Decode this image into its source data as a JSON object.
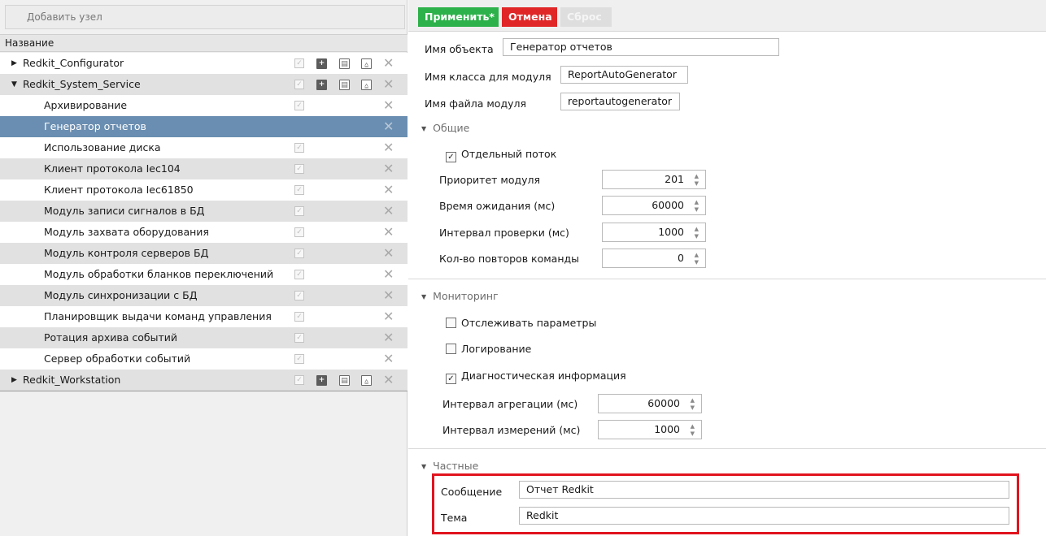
{
  "left_pane": {
    "add_node": "Добавить узел",
    "column_header": "Название",
    "tree": [
      {
        "label": "Redkit_Configurator",
        "level": 0,
        "arrow": "▶",
        "tools": true
      },
      {
        "label": "Redkit_System_Service",
        "level": 0,
        "arrow": "▼",
        "tools": true
      },
      {
        "label": "Архивирование",
        "level": 1
      },
      {
        "label": "Генератор отчетов",
        "level": 1,
        "selected": true
      },
      {
        "label": "Использование диска",
        "level": 1
      },
      {
        "label": "Клиент протокола Iec104",
        "level": 1
      },
      {
        "label": "Клиент протокола Iec61850",
        "level": 1
      },
      {
        "label": "Модуль записи сигналов в БД",
        "level": 1
      },
      {
        "label": "Модуль захвата оборудования",
        "level": 1
      },
      {
        "label": "Модуль контроля серверов БД",
        "level": 1
      },
      {
        "label": "Модуль обработки бланков переключений",
        "level": 1
      },
      {
        "label": "Модуль синхронизации с БД",
        "level": 1
      },
      {
        "label": "Планировщик выдачи команд управления",
        "level": 1
      },
      {
        "label": "Ротация архива событий",
        "level": 1
      },
      {
        "label": "Сервер обработки событий",
        "level": 1
      },
      {
        "label": "Redkit_Workstation",
        "level": 0,
        "arrow": "▶",
        "tools": true
      }
    ]
  },
  "toolbar": {
    "apply_label": "Применить*",
    "cancel_label": "Отмена",
    "reset_label": "Сброс",
    "colors": {
      "apply": "#2db14a",
      "cancel": "#e02626",
      "reset": "#dedede"
    }
  },
  "properties": {
    "object_name_label": "Имя объекта",
    "object_name_value": "Генератор отчетов",
    "module_class_label": "Имя класса для модуля",
    "module_class_value": "ReportAutoGenerator",
    "module_file_label": "Имя файла модуля",
    "module_file_value": "reportautogenerator"
  },
  "general": {
    "title": "Общие",
    "separate_thread_label": "Отдельный поток",
    "separate_thread_checked": true,
    "priority_label": "Приоритет модуля",
    "priority_value": "201",
    "wait_time_label": "Время ожидания (мс)",
    "wait_time_value": "60000",
    "check_interval_label": "Интервал проверки (мс)",
    "check_interval_value": "1000",
    "retry_count_label": "Кол-во повторов команды",
    "retry_count_value": "0"
  },
  "monitoring": {
    "title": "Мониторинг",
    "track_params_label": "Отслеживать параметры",
    "track_params_checked": false,
    "logging_label": "Логирование",
    "logging_checked": false,
    "diagnostics_label": "Диагностическая информация",
    "diagnostics_checked": true,
    "aggregation_interval_label": "Интервал агрегации (мс)",
    "aggregation_interval_value": "60000",
    "measure_interval_label": "Интервал измерений (мс)",
    "measure_interval_value": "1000"
  },
  "private": {
    "title": "Частные",
    "message_label": "Сообщение",
    "message_value": "Отчет Redkit",
    "subject_label": "Тема",
    "subject_value": "Redkit",
    "highlight_color": "#e1141e"
  }
}
